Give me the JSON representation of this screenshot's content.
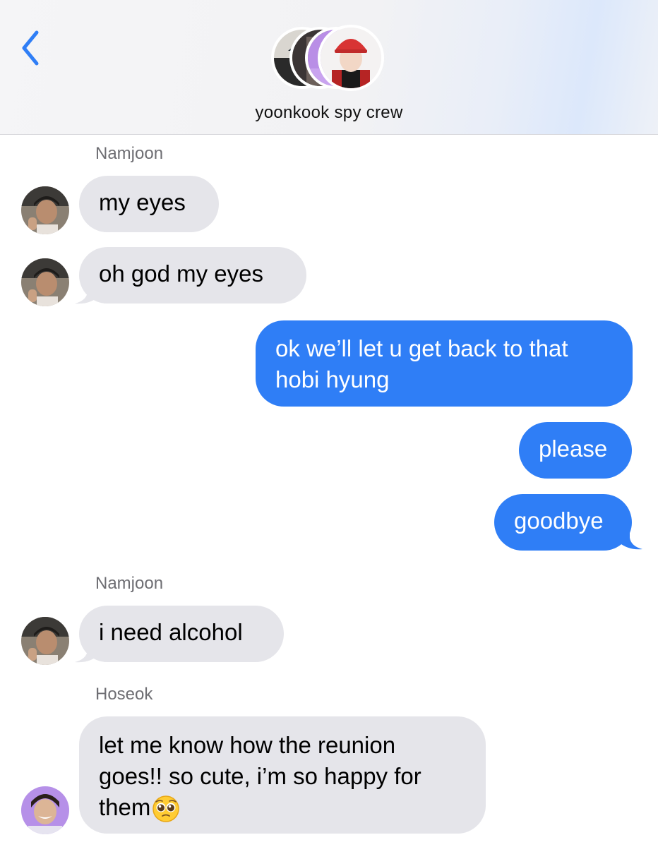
{
  "header": {
    "title": "yoonkook spy crew",
    "back_icon": "chevron-left-icon",
    "accent_color": "#2f7ef6"
  },
  "messages": [
    {
      "sender": "Namjoon",
      "direction": "incoming",
      "text": "my eyes"
    },
    {
      "direction": "incoming",
      "text": "oh god my eyes"
    },
    {
      "direction": "outgoing",
      "lines": [
        "ok we’ll let u get back to that",
        "hobi hyung"
      ]
    },
    {
      "direction": "outgoing",
      "text": "please"
    },
    {
      "direction": "outgoing",
      "text": "goodbye"
    },
    {
      "sender": "Namjoon",
      "direction": "incoming",
      "text": "i need alcohol"
    },
    {
      "sender": "Hoseok",
      "direction": "incoming",
      "lines": [
        "let me know how the reunion",
        "goes!! so cute, i’m so happy for",
        "them"
      ],
      "emoji": "pleading-face-icon"
    }
  ],
  "colors": {
    "incoming_bubble": "#e5e5ea",
    "outgoing_bubble": "#2f7ef6",
    "sender_name": "#6e6e73"
  }
}
